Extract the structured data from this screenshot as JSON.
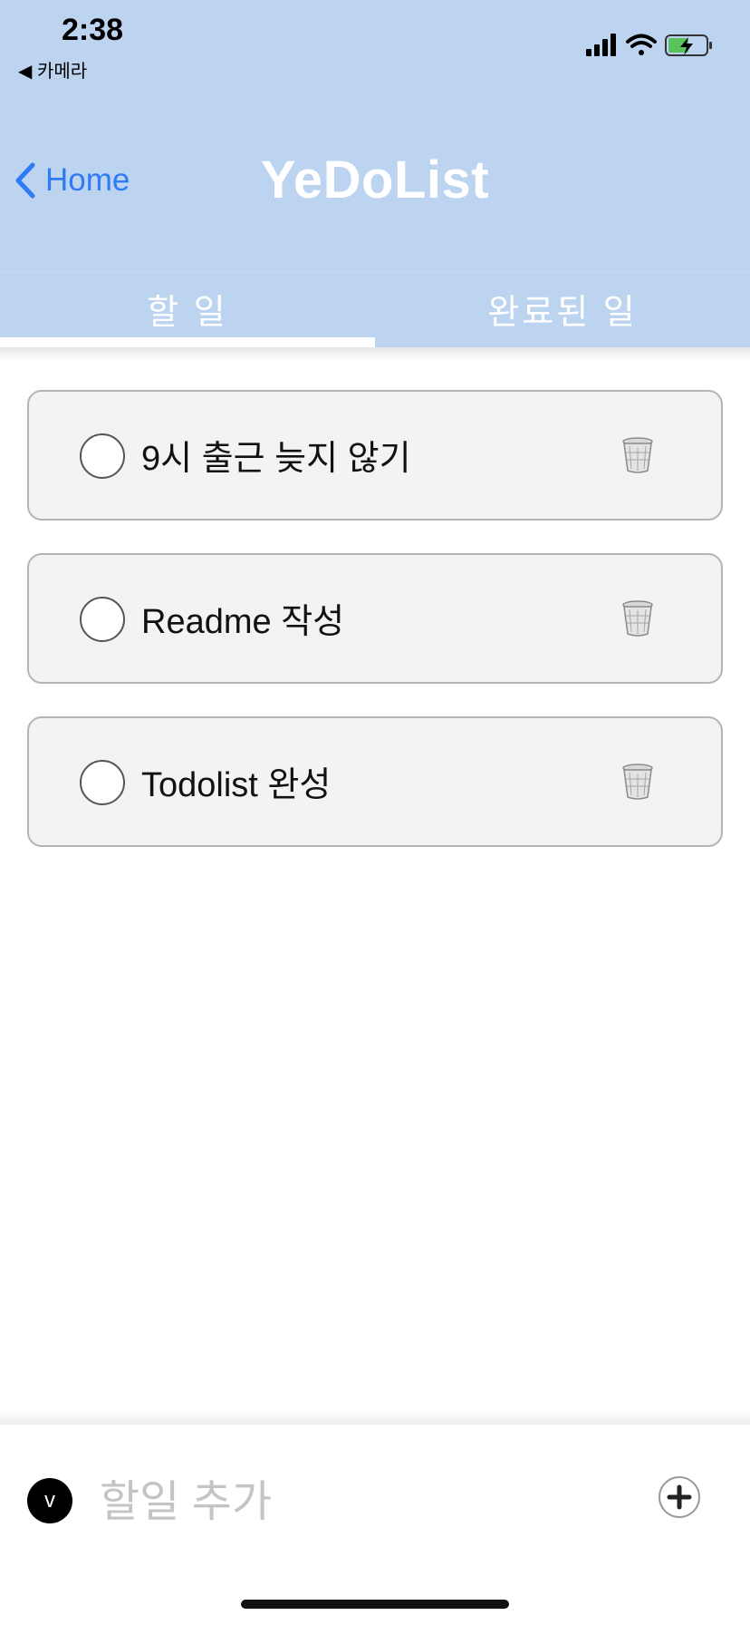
{
  "status_bar": {
    "time": "2:38",
    "back_app": "◀ 카메라"
  },
  "nav": {
    "back_label": "Home",
    "title": "YeDoList"
  },
  "tabs": [
    {
      "label": "할 일",
      "selected": true
    },
    {
      "label": "완료된 일",
      "selected": false
    }
  ],
  "todos": [
    {
      "text": "9시 출근 늦지 않기",
      "done": false
    },
    {
      "text": "Readme 작성",
      "done": false
    },
    {
      "text": "Todolist 완성",
      "done": false
    }
  ],
  "bottom_bar": {
    "avatar_letter": "v",
    "input_placeholder": "할일 추가",
    "input_value": ""
  },
  "icons": {
    "back": "chevron-left-icon",
    "delete": "trash-icon",
    "add": "plus-icon",
    "check": "circle-icon"
  },
  "colors": {
    "header": "#bdd4f1",
    "accent": "#2f7bf6",
    "card_bg": "#f3f3f3"
  }
}
